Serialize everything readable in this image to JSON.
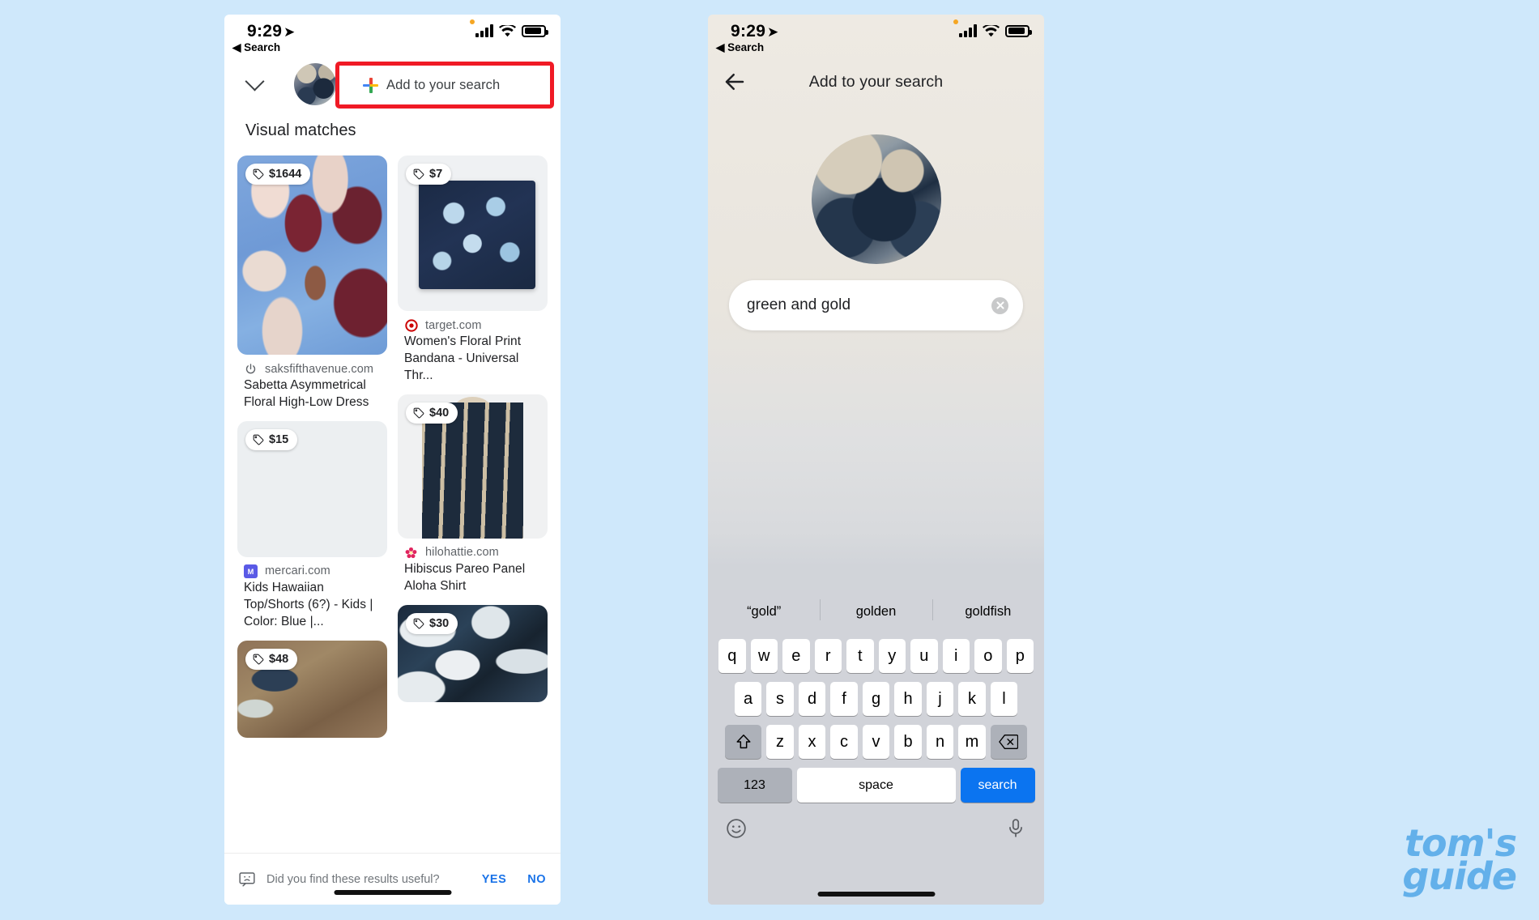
{
  "status_bar": {
    "time": "9:29",
    "back_label": "Search",
    "location_arrow_icon": "location-arrow-icon",
    "signal_icon": "cellular-signal-icon",
    "wifi_icon": "wifi-icon",
    "battery_icon": "battery-icon"
  },
  "left_phone": {
    "collapse_icon": "chevron-down-icon",
    "query_thumbnail": "query-image-thumbnail",
    "add_to_search": {
      "label": "Add to your search",
      "icon": "google-plus-icon",
      "highlight_color": "#f01a25"
    },
    "section_heading": "Visual matches",
    "results": [
      {
        "price": "$1644",
        "domain": "saksfifthavenue.com",
        "favicon": "power-icon",
        "title": "Sabetta Asymmetrical Floral High-Low Dress",
        "image": "blue-floral-fabric"
      },
      {
        "price": "$7",
        "domain": "target.com",
        "favicon": "target-bullseye-icon",
        "title": "Women's Floral Print Bandana - Universal Thr...",
        "image": "navy-floral-bandana"
      },
      {
        "price": "$15",
        "domain": "mercari.com",
        "favicon": "mercari-m-icon",
        "title": "Kids Hawaiian Top/Shorts (6?) - Kids | Color: Blue |...",
        "image": "dark-floral-fabric"
      },
      {
        "price": "$40",
        "domain": "hilohattie.com",
        "favicon": "hibiscus-flower-icon",
        "title": "Hibiscus Pareo Panel Aloha Shirt",
        "image": "aloha-shirt-on-mannequin"
      },
      {
        "price": "$48",
        "domain": "",
        "favicon": "",
        "title": "",
        "image": "brown-fabric"
      },
      {
        "price": "$30",
        "domain": "",
        "favicon": "",
        "title": "",
        "image": "seafoam-dark-floral"
      }
    ],
    "feedback": {
      "icon": "feedback-chat-icon",
      "question": "Did you find these results useful?",
      "yes_label": "YES",
      "no_label": "NO",
      "link_color": "#1a73e8"
    }
  },
  "right_phone": {
    "back_icon": "back-arrow-icon",
    "title": "Add to your search",
    "query_thumbnail": "query-image-thumbnail",
    "search_field": {
      "value": "green and gold",
      "clear_icon": "clear-circle-x-icon"
    },
    "keyboard": {
      "suggestions": [
        "“gold”",
        "golden",
        "goldfish"
      ],
      "row1": [
        "q",
        "w",
        "e",
        "r",
        "t",
        "y",
        "u",
        "i",
        "o",
        "p"
      ],
      "row2": [
        "a",
        "s",
        "d",
        "f",
        "g",
        "h",
        "j",
        "k",
        "l"
      ],
      "row3": [
        "z",
        "x",
        "c",
        "v",
        "b",
        "n",
        "m"
      ],
      "shift_icon": "shift-up-arrow-icon",
      "backspace_icon": "backspace-delete-icon",
      "numbers_label": "123",
      "space_label": "space",
      "search_label": "search",
      "search_key_color": "#0b74f0",
      "emoji_icon": "emoji-smiley-icon",
      "mic_icon": "microphone-icon"
    }
  },
  "watermark": {
    "line1": "tom's",
    "line2": "guide",
    "color": "#63b0ea"
  },
  "background_color": "#cfe8fb"
}
